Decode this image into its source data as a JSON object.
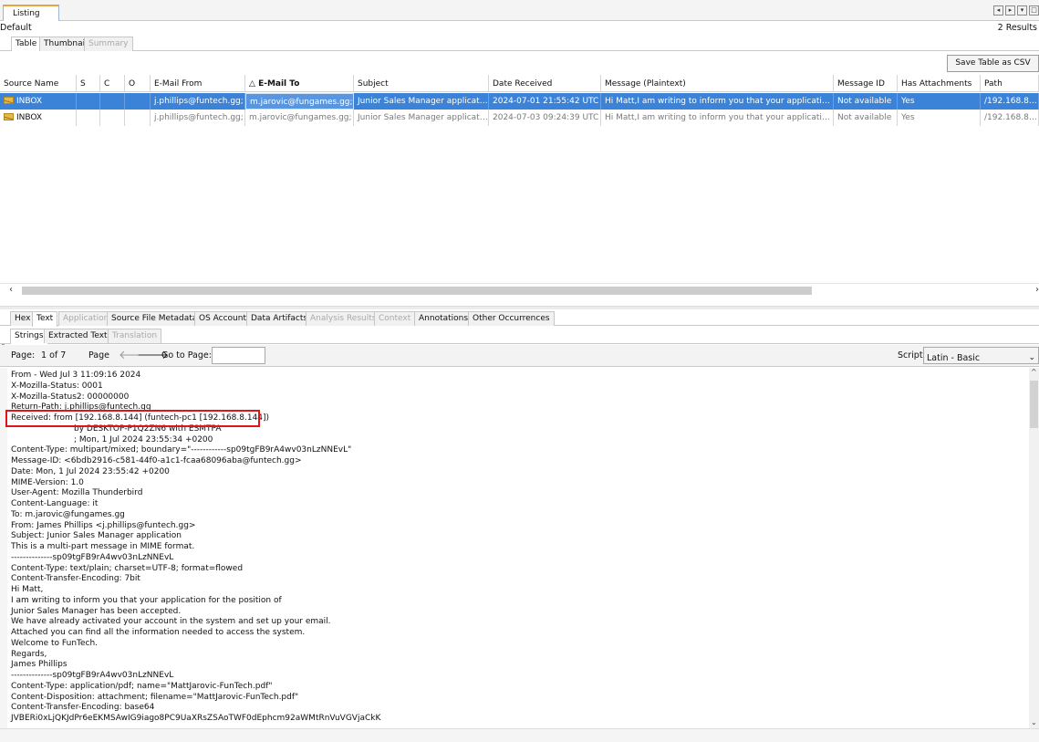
{
  "window": {
    "listing_tab": "Listing",
    "default_label": "Default",
    "results_count": "2 Results"
  },
  "view_tabs": [
    {
      "label": "Table",
      "active": true,
      "disabled": false
    },
    {
      "label": "Thumbnail",
      "active": false,
      "disabled": false
    },
    {
      "label": "Summary",
      "active": false,
      "disabled": true
    }
  ],
  "toolbar": {
    "save_csv": "Save Table as CSV"
  },
  "table": {
    "columns": [
      "Source Name",
      "S",
      "C",
      "O",
      "E-Mail From",
      "E-Mail To",
      "Subject",
      "Date Received",
      "Message (Plaintext)",
      "Message ID",
      "Has Attachments",
      "Path"
    ],
    "sorted_column": "E-Mail To",
    "sort_indicator": "△",
    "rows": [
      {
        "source": "INBOX",
        "s": "",
        "c": "",
        "o": "",
        "from": "j.phillips@funtech.gg;",
        "to": "m.jarovic@fungames.gg;",
        "subject": "Junior Sales Manager application",
        "date": "2024-07-01 21:55:42 UTC",
        "message": "Hi Matt,I am writing to inform you that your application for the position of Junior Sales Manager has been accepted.",
        "message_id": "Not available",
        "attachments": "Yes",
        "path": "/192.168.8.144"
      },
      {
        "source": "INBOX",
        "s": "",
        "c": "",
        "o": "",
        "from": "j.phillips@funtech.gg;",
        "to": "m.jarovic@fungames.gg;",
        "subject": "Junior Sales Manager application",
        "date": "2024-07-03 09:24:39 UTC",
        "message": "Hi Matt,I am writing to inform you that your application for the position of Junior Sales Manager has been accepted.",
        "message_id": "Not available",
        "attachments": "Yes",
        "path": "/192.168.8.144"
      }
    ]
  },
  "viewer_tabs": [
    {
      "label": "Hex",
      "active": false,
      "disabled": false
    },
    {
      "label": "Text",
      "active": true,
      "disabled": false
    },
    {
      "label": "Application",
      "active": false,
      "disabled": true
    },
    {
      "label": "Source File Metadata",
      "active": false,
      "disabled": false
    },
    {
      "label": "OS Account",
      "active": false,
      "disabled": false
    },
    {
      "label": "Data Artifacts",
      "active": false,
      "disabled": false
    },
    {
      "label": "Analysis Results",
      "active": false,
      "disabled": true
    },
    {
      "label": "Context",
      "active": false,
      "disabled": true
    },
    {
      "label": "Annotations",
      "active": false,
      "disabled": false
    },
    {
      "label": "Other Occurrences",
      "active": false,
      "disabled": false
    }
  ],
  "sub_tabs": [
    {
      "label": "Strings",
      "active": true,
      "disabled": false
    },
    {
      "label": "Extracted Text",
      "active": false,
      "disabled": false
    },
    {
      "label": "Translation",
      "active": false,
      "disabled": true
    }
  ],
  "pager": {
    "page_label": "Page:",
    "page_value": "1 of 7",
    "page_word": "Page",
    "goto_label": "Go to Page:",
    "goto_value": "",
    "script_label": "Script:",
    "script_value": "Latin - Basic"
  },
  "text_lines": [
    {
      "text": "From - Wed Jul  3 11:09:16 2024",
      "indent": false
    },
    {
      "text": "X-Mozilla-Status: 0001",
      "indent": false
    },
    {
      "text": "X-Mozilla-Status2: 00000000",
      "indent": false
    },
    {
      "text": "Return-Path: j.phillips@funtech.gg",
      "indent": false
    },
    {
      "text": "Received: from [192.168.8.144] (funtech-pc1 [192.168.8.144])",
      "indent": false
    },
    {
      "text": "by DESKTOP-P1Q2ZN6 with ESMTPA",
      "indent": true
    },
    {
      "text": "; Mon, 1 Jul 2024 23:55:34 +0200",
      "indent": true
    },
    {
      "text": "Content-Type: multipart/mixed; boundary=\"------------sp09tgFB9rA4wv03nLzNNEvL\"",
      "indent": false
    },
    {
      "text": "Message-ID: <6bdb2916-c581-44f0-a1c1-fcaa68096aba@funtech.gg>",
      "indent": false
    },
    {
      "text": "Date: Mon, 1 Jul 2024 23:55:42 +0200",
      "indent": false
    },
    {
      "text": "MIME-Version: 1.0",
      "indent": false
    },
    {
      "text": "User-Agent: Mozilla Thunderbird",
      "indent": false
    },
    {
      "text": "Content-Language: it",
      "indent": false
    },
    {
      "text": "To: m.jarovic@fungames.gg",
      "indent": false
    },
    {
      "text": "From: James Phillips <j.phillips@funtech.gg>",
      "indent": false
    },
    {
      "text": "Subject: Junior Sales Manager application",
      "indent": false
    },
    {
      "text": "This is a multi-part message in MIME format.",
      "indent": false
    },
    {
      "text": "--------------sp09tgFB9rA4wv03nLzNNEvL",
      "indent": false
    },
    {
      "text": "Content-Type: text/plain; charset=UTF-8; format=flowed",
      "indent": false
    },
    {
      "text": "Content-Transfer-Encoding: 7bit",
      "indent": false
    },
    {
      "text": "Hi Matt,",
      "indent": false
    },
    {
      "text": "I am writing to inform you that your application for the position of",
      "indent": false
    },
    {
      "text": "Junior Sales Manager has been accepted.",
      "indent": false
    },
    {
      "text": "We have already activated your account in the system and set up your email.",
      "indent": false
    },
    {
      "text": "Attached you can find all the information needed to access the system.",
      "indent": false
    },
    {
      "text": "Welcome to FunTech.",
      "indent": false
    },
    {
      "text": "Regards,",
      "indent": false
    },
    {
      "text": "James Phillips",
      "indent": false
    },
    {
      "text": "--------------sp09tgFB9rA4wv03nLzNNEvL",
      "indent": false
    },
    {
      "text": "Content-Type: application/pdf; name=\"MattJarovic-FunTech.pdf\"",
      "indent": false
    },
    {
      "text": "Content-Disposition: attachment; filename=\"MattJarovic-FunTech.pdf\"",
      "indent": false
    },
    {
      "text": "Content-Transfer-Encoding: base64",
      "indent": false
    },
    {
      "text": "JVBERi0xLjQKJdPr6eEKMSAwIG9iago8PC9UaXRsZSAoTWF0dEphcm92aWMtRnVuVGVjaCkK",
      "indent": false
    }
  ],
  "colors": {
    "selection": "#3b83d8",
    "highlight": "#e0141b",
    "tab_accent": "#e8a33d"
  },
  "icons": {
    "source_icon": "mail-inbox-icon"
  }
}
